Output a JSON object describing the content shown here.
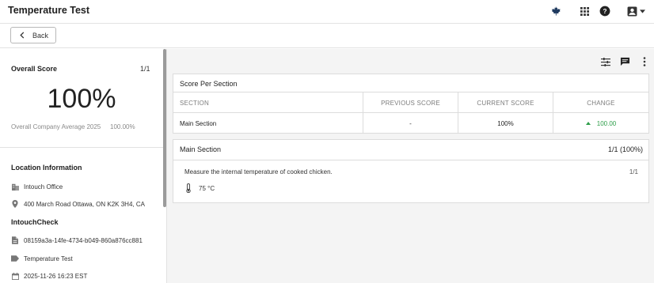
{
  "header": {
    "title": "Temperature Test",
    "icons": [
      "maple-leaf-icon",
      "apps-grid-icon",
      "help-icon",
      "account-icon",
      "caret-down-icon"
    ]
  },
  "toolbar": {
    "back_label": "Back"
  },
  "score": {
    "label": "Overall Score",
    "fraction": "1/1",
    "percent": "100%",
    "company_avg_label": "Overall Company Average 2025",
    "company_avg_value": "100.00%"
  },
  "location": {
    "heading": "Location Information",
    "name": "Intouch Office",
    "address": "400 March Road Ottawa, ON K2K 3H4, CA"
  },
  "check": {
    "heading": "IntouchCheck",
    "id": "08159a3a-14fe-4734-b049-860a876cc881",
    "name": "Temperature Test",
    "datetime": "2025-11-26 16:23 EST"
  },
  "score_per_section": {
    "title": "Score Per Section",
    "columns": [
      "SECTION",
      "PREVIOUS SCORE",
      "CURRENT SCORE",
      "CHANGE"
    ],
    "rows": [
      {
        "section": "Main Section",
        "previous": "-",
        "current": "100%",
        "change": "100.00"
      }
    ]
  },
  "main_section": {
    "title": "Main Section",
    "score": "1/1 (100%)",
    "question": "Measure the internal temperature of cooked chicken.",
    "question_score": "1/1",
    "answer": "75 °C"
  },
  "colors": {
    "positive": "#2e9e4a",
    "accent": "#1f3a5f"
  }
}
